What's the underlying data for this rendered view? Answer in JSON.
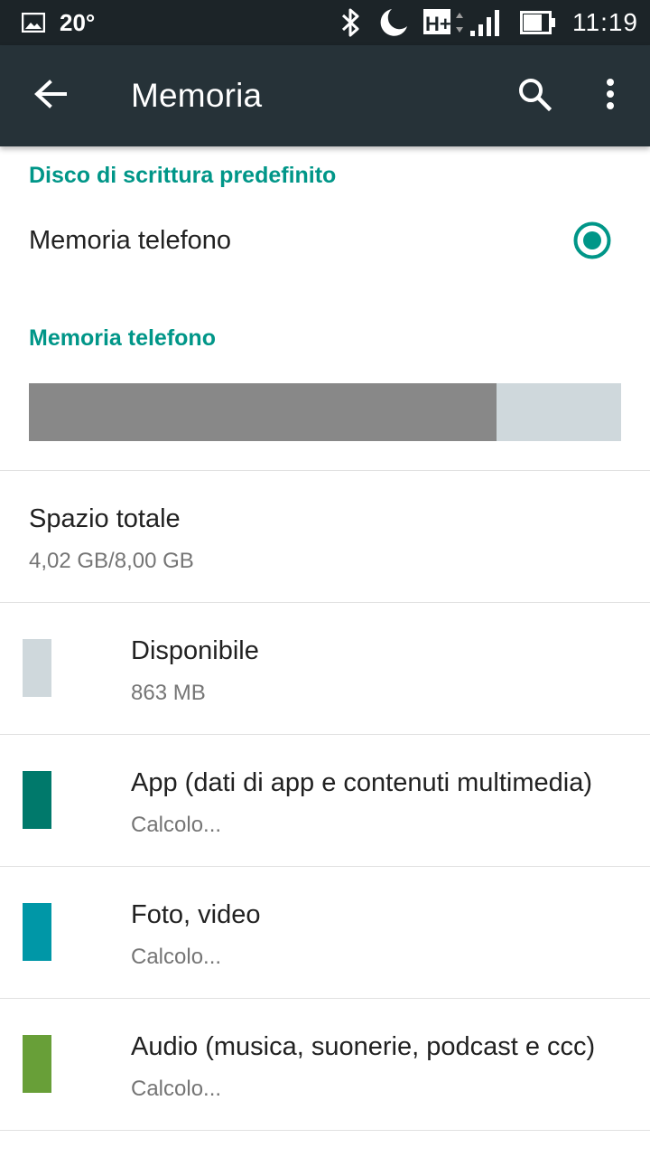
{
  "status_bar": {
    "temperature": "20°",
    "time": "11:19",
    "network": "H+",
    "icons": [
      "image-icon",
      "bluetooth-icon",
      "do-not-disturb-moon-icon",
      "h-plus-network-icon",
      "signal-icon",
      "battery-icon"
    ]
  },
  "toolbar": {
    "title": "Memoria",
    "back_icon": "arrow-back-icon",
    "search_icon": "search-icon",
    "more_icon": "more-vert-icon"
  },
  "default_disk": {
    "header": "Disco di scrittura predefinito",
    "option_label": "Memoria telefono",
    "selected": true
  },
  "phone_memory": {
    "header": "Memoria telefono",
    "used_fraction": 0.79,
    "colors": {
      "used": "#888888",
      "free": "#cfd8dc"
    }
  },
  "total": {
    "title": "Spazio totale",
    "value": "4,02 GB/8,00 GB"
  },
  "categories": [
    {
      "title": "Disponibile",
      "subtitle": "863 MB",
      "color": "#cfd8dc"
    },
    {
      "title": "App (dati di app e contenuti multimedia)",
      "subtitle": "Calcolo...",
      "color": "#00796b"
    },
    {
      "title": "Foto, video",
      "subtitle": "Calcolo...",
      "color": "#0097a7"
    },
    {
      "title": "Audio (musica, suonerie, podcast e ccc)",
      "subtitle": "Calcolo...",
      "color": "#689f38"
    }
  ],
  "accent_color": "#009688"
}
